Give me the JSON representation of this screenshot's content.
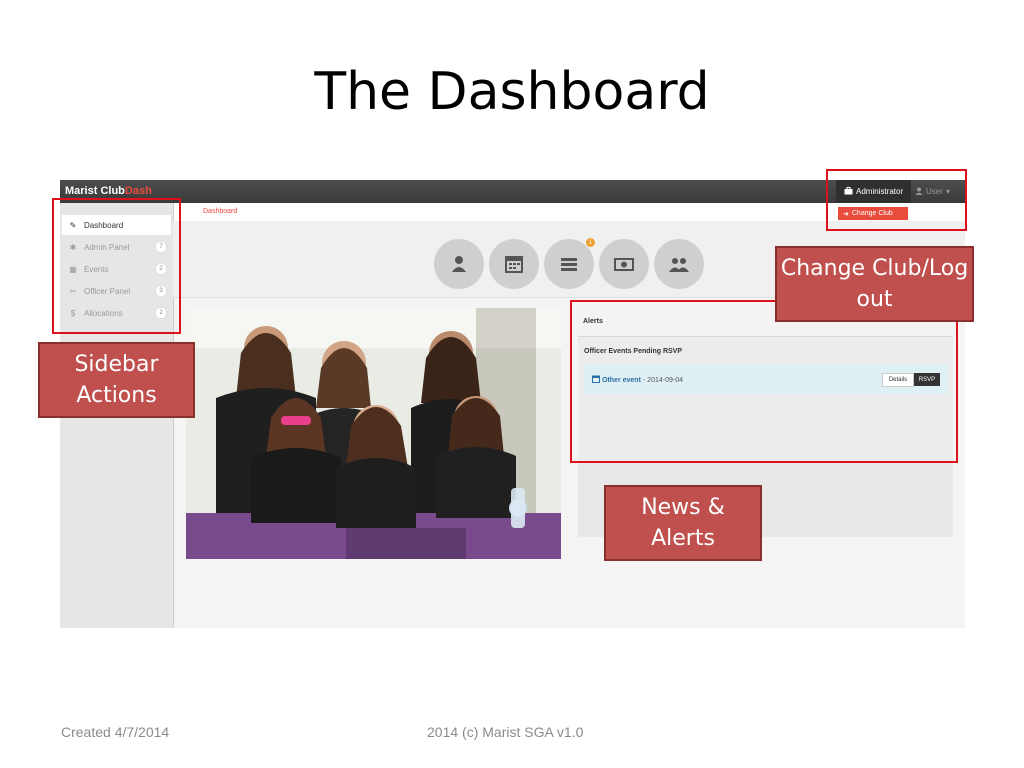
{
  "slide": {
    "title": "The Dashboard",
    "footer_left": "Created 4/7/2014",
    "footer_center": "2014 (c) Marist SGA v1.0"
  },
  "app": {
    "brand_main": "Marist Club",
    "brand_accent": "Dash",
    "nav": {
      "admin_label": "Administrator",
      "user_label": "User",
      "change_club_label": "Change Club"
    },
    "breadcrumb": "Dashboard",
    "sidebar": {
      "items": [
        {
          "label": "Dashboard",
          "icon": "pencil-icon",
          "badge": ""
        },
        {
          "label": "Admin Panel",
          "icon": "asterisk-icon",
          "badge": "7"
        },
        {
          "label": "Events",
          "icon": "calendar-icon",
          "badge": "2"
        },
        {
          "label": "Officer Panel",
          "icon": "tools-icon",
          "badge": "3"
        },
        {
          "label": "Allocations",
          "icon": "dollar-icon",
          "badge": "2"
        }
      ]
    },
    "quick_icons": [
      {
        "icon": "user-icon"
      },
      {
        "icon": "calendar-icon"
      },
      {
        "icon": "list-icon",
        "notification": "1"
      },
      {
        "icon": "money-icon"
      },
      {
        "icon": "group-icon"
      }
    ],
    "alerts": {
      "title": "Alerts",
      "section_title": "Officer Events Pending RSVP",
      "event_name": "Other event",
      "event_date": "- 2014-09-04",
      "details_label": "Details",
      "rsvp_label": "RSVP"
    }
  },
  "callouts": {
    "change_club": "Change Club/Log out",
    "sidebar": "Sidebar Actions",
    "news": "News & Alerts"
  },
  "colors": {
    "accent": "#e74c3c",
    "highlight": "#e0101b",
    "callout_bg": "#c0504d",
    "navbar": "#3a3a3a"
  }
}
